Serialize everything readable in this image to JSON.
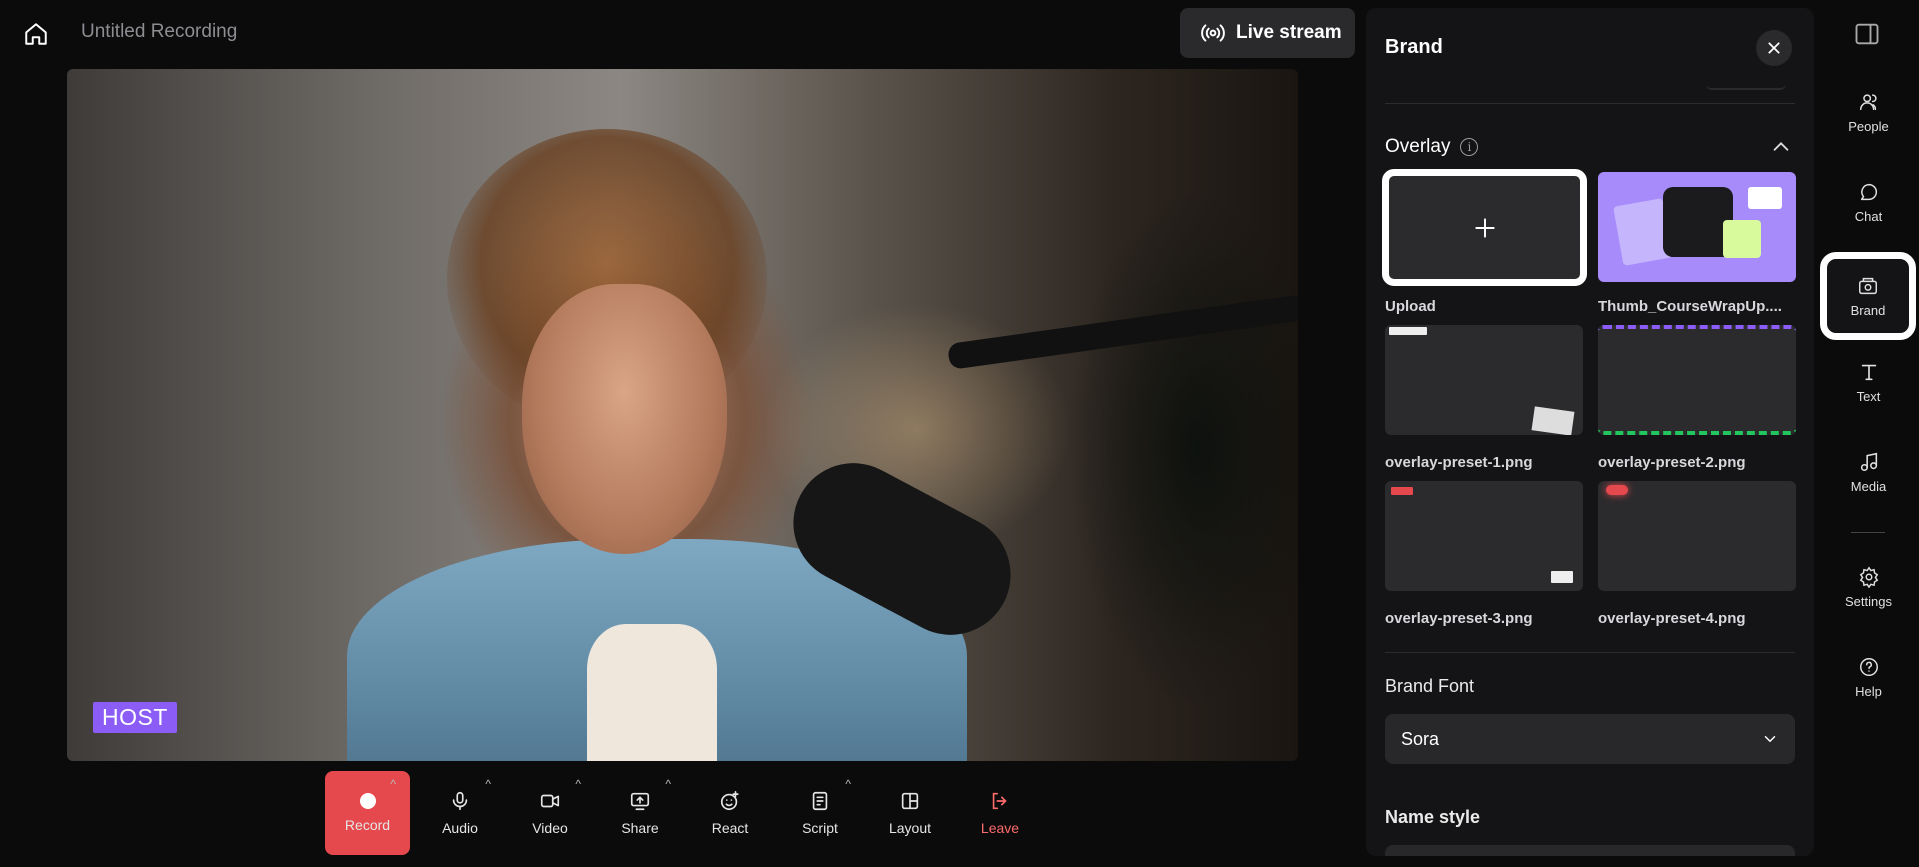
{
  "header": {
    "title": "Untitled Recording",
    "live_label": "Live stream"
  },
  "stage": {
    "host_tag": "HOST"
  },
  "toolbar": [
    {
      "key": "record",
      "label": "Record",
      "caret": true
    },
    {
      "key": "audio",
      "label": "Audio",
      "caret": true
    },
    {
      "key": "video",
      "label": "Video",
      "caret": true
    },
    {
      "key": "share",
      "label": "Share",
      "caret": true
    },
    {
      "key": "react",
      "label": "React",
      "caret": false
    },
    {
      "key": "script",
      "label": "Script",
      "caret": true
    },
    {
      "key": "layout",
      "label": "Layout",
      "caret": false
    },
    {
      "key": "leave",
      "label": "Leave",
      "caret": false
    }
  ],
  "panel": {
    "title": "Brand",
    "overlay": {
      "heading": "Overlay",
      "items": [
        {
          "label": "Upload"
        },
        {
          "label": "Thumb_CourseWrapUp...."
        },
        {
          "label": "overlay-preset-1.png"
        },
        {
          "label": "overlay-preset-2.png"
        },
        {
          "label": "overlay-preset-3.png"
        },
        {
          "label": "overlay-preset-4.png"
        }
      ]
    },
    "brand_font": {
      "heading": "Brand Font",
      "value": "Sora"
    },
    "name_style": {
      "heading": "Name style"
    }
  },
  "rail": {
    "items": [
      {
        "key": "people",
        "label": "People"
      },
      {
        "key": "chat",
        "label": "Chat"
      },
      {
        "key": "brand",
        "label": "Brand",
        "active": true
      },
      {
        "key": "text",
        "label": "Text"
      },
      {
        "key": "media",
        "label": "Media"
      },
      {
        "key": "settings",
        "label": "Settings"
      },
      {
        "key": "help",
        "label": "Help"
      }
    ]
  },
  "colors": {
    "record": "#e5484d",
    "accent_purple": "#8b5cf6",
    "panel_bg": "#141416",
    "leave": "#ff6b6b"
  }
}
